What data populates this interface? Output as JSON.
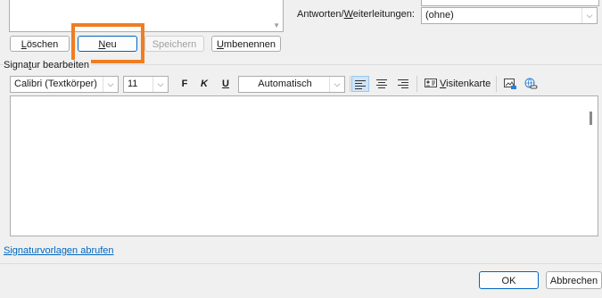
{
  "signature_list": {
    "scroll_glyph": "▼"
  },
  "buttons": {
    "delete": {
      "pre": "",
      "acc": "L",
      "post": "öschen"
    },
    "new": {
      "pre": "",
      "acc": "N",
      "post": "eu"
    },
    "save": {
      "pre": "",
      "acc": "",
      "post": "Speichern"
    },
    "rename": {
      "pre": "",
      "acc": "U",
      "post": "mbenennen"
    }
  },
  "replies": {
    "label_pre": "Antworten/",
    "label_acc": "W",
    "label_post": "eiterleitungen:",
    "value": "(ohne)"
  },
  "edit_section": {
    "pre": "Signa",
    "acc": "t",
    "post": "ur bearbeiten"
  },
  "toolbar": {
    "font": "Calibri (Textkörper)",
    "size": "11",
    "bold": "F",
    "italic": "K",
    "underline": "U",
    "color": "Automatisch",
    "business_card_pre": "",
    "business_card_acc": "V",
    "business_card_post": "isitenkarte"
  },
  "templates_link": "Signaturvorlagen abrufen",
  "footer": {
    "ok": "OK",
    "cancel": "Abbrechen"
  },
  "colors": {
    "highlight": "#ef7d22",
    "accent": "#0067c0",
    "link": "#0067c0"
  },
  "icons": [
    "chevron-down-icon",
    "align-left-icon",
    "align-center-icon",
    "align-right-icon",
    "business-card-icon",
    "picture-icon",
    "hyperlink-icon"
  ]
}
